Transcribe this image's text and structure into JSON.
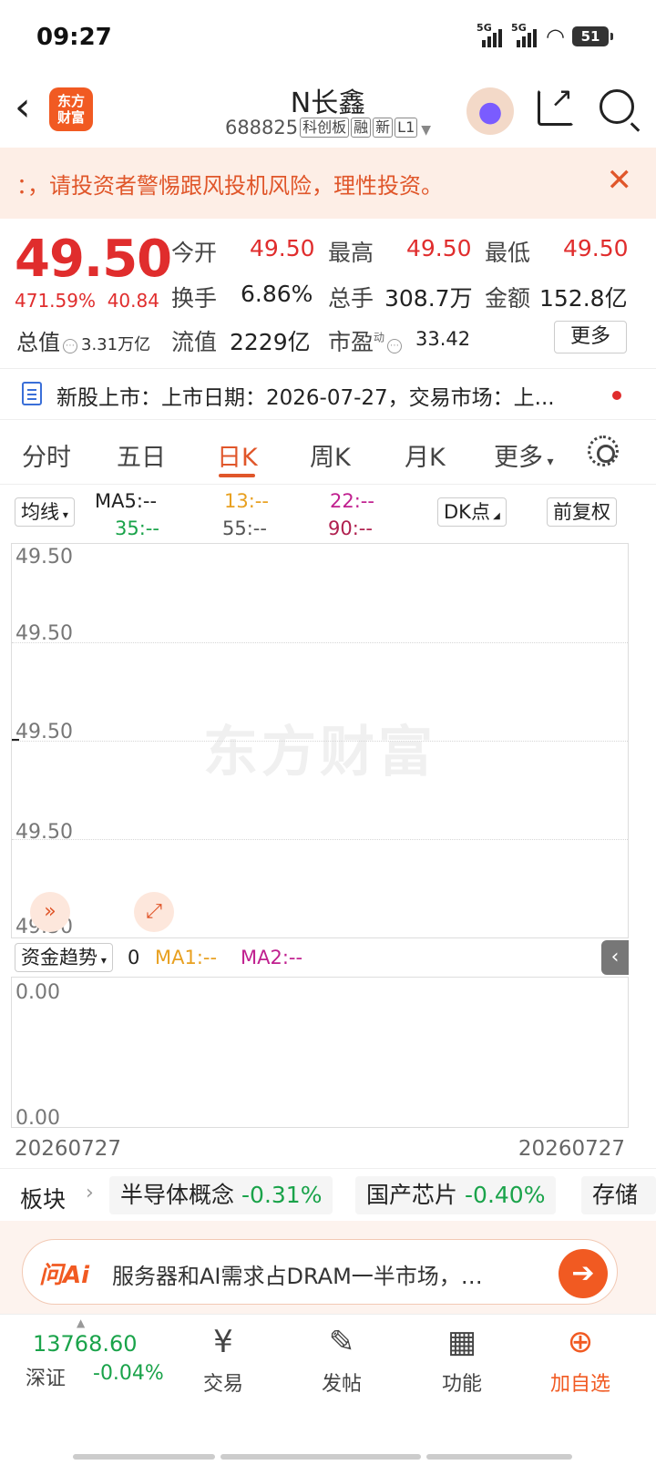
{
  "status_bar": {
    "time": "09:27",
    "net1": "5G",
    "net2": "5G",
    "battery": "51"
  },
  "header": {
    "back_icon": "‹",
    "logo_text_line1": "东方",
    "logo_text_line2": "财富",
    "title": "N长鑫",
    "code": "688825",
    "tags": [
      "科创板",
      "融",
      "新",
      "L1"
    ]
  },
  "warning": {
    "text": "：，请投资者警惕跟风投机风险，理性投资。",
    "close": "✕"
  },
  "quote": {
    "price": "49.50",
    "change_pct": "471.59%",
    "change_amt": "40.84",
    "total_cap_label": "总值",
    "total_cap_value": "3.31万亿",
    "open_label": "今开",
    "open_value": "49.50",
    "high_label": "最高",
    "high_value": "49.50",
    "low_label": "最低",
    "low_value": "49.50",
    "turnover_label": "换手",
    "turnover_value": "6.86%",
    "volume_label": "总手",
    "volume_value": "308.7万",
    "amount_label": "金额",
    "amount_value": "152.8亿",
    "float_label": "流值",
    "float_value": "2229亿",
    "pe_label": "市盈",
    "pe_sup": "动",
    "pe_value": "33.42",
    "more_label": "更多"
  },
  "news": {
    "text": "新股上市：上市日期：2026-07-27，交易市场：上..."
  },
  "tabs": [
    "分时",
    "五日",
    "日K",
    "周K",
    "月K",
    "更多"
  ],
  "active_tab": "日K",
  "ma_bar": {
    "selector": "均线",
    "ma5": "MA5:--",
    "ma13": "13:--",
    "ma22": "22:--",
    "ma35": "35:--",
    "ma55": "55:--",
    "ma90": "90:--",
    "dk": "DK点",
    "adjust": "前复权"
  },
  "main_chart": {
    "y_labels": [
      "49.50",
      "49.50",
      "49.50",
      "49.50",
      "49.50"
    ],
    "watermark": "东方财富"
  },
  "sub_chart": {
    "selector": "资金趋势",
    "value": "0",
    "ma1": "MA1:--",
    "ma2": "MA2:--",
    "y_top": "0.00",
    "y_bottom": "0.00"
  },
  "dates": {
    "start": "20260727",
    "end": "20260727"
  },
  "sectors": {
    "label": "板块",
    "items": [
      {
        "name": "半导体概念",
        "pct": "-0.31%"
      },
      {
        "name": "国产芯片",
        "pct": "-0.40%"
      },
      {
        "name": "存储",
        "pct": ""
      }
    ]
  },
  "ai": {
    "logo": "问Ai",
    "text": "服务器和AI需求占DRAM一半市场，…"
  },
  "bottom_nav": {
    "index_value": "13768.60",
    "index_name": "深证",
    "index_change": "-0.04%",
    "items": [
      "交易",
      "发帖",
      "功能",
      "加自选"
    ]
  },
  "colors": {
    "up": "#e02d2d",
    "down": "#1aa34a",
    "accent": "#f15a22",
    "ma13": "#e8a020",
    "ma22": "#c0208f",
    "ma35": "#1aa34a",
    "ma90": "#b0204f"
  }
}
